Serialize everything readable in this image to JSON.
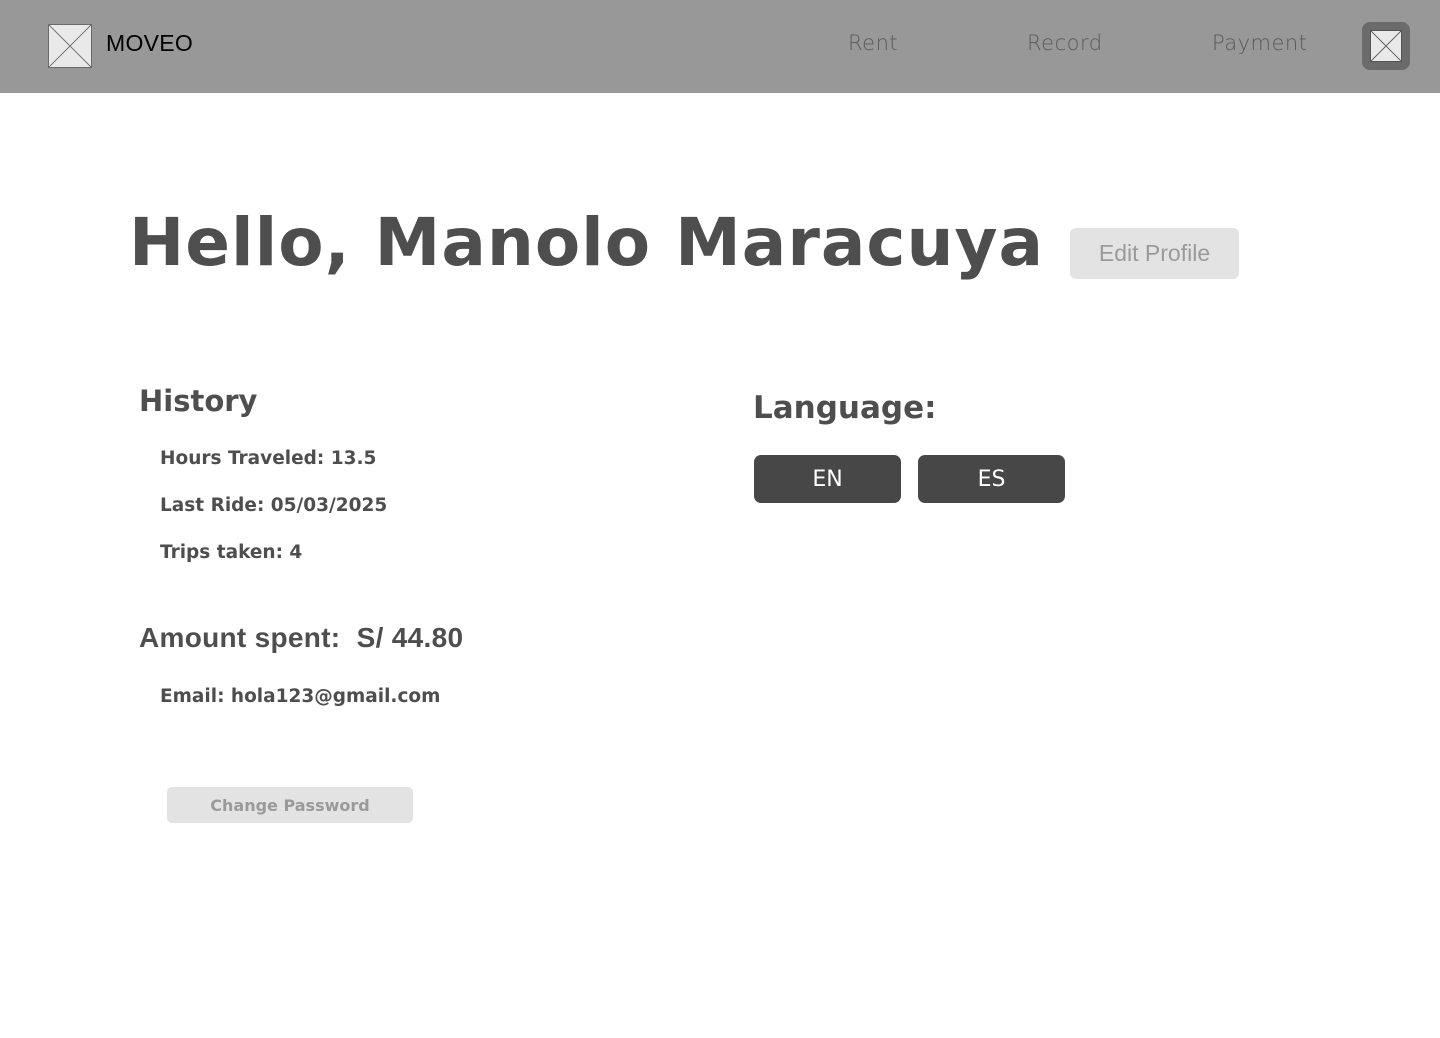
{
  "header": {
    "brand": "MOVEO",
    "nav": {
      "rent": "Rent",
      "record": "Record",
      "payment": "Payment"
    }
  },
  "profile": {
    "greeting": "Hello, Manolo Maracuya",
    "edit_profile_label": "Edit Profile"
  },
  "history": {
    "title": "History",
    "hours_traveled": "Hours Traveled: 13.5",
    "last_ride": "Last Ride: 05/03/2025",
    "trips_taken": "Trips taken: 4"
  },
  "amount": {
    "label": "Amount spent:",
    "value": "S/ 44.80"
  },
  "account": {
    "email": "Email: hola123@gmail.com",
    "change_password_label": "Change Password"
  },
  "language": {
    "title": "Language:",
    "options": [
      "EN",
      "ES"
    ]
  },
  "colors": {
    "header_bg": "#989898",
    "heading_text": "#4e4e4e",
    "light_button_bg": "#e3e3e3",
    "light_button_text": "#9a9a9a",
    "dark_button_bg": "#474747"
  }
}
